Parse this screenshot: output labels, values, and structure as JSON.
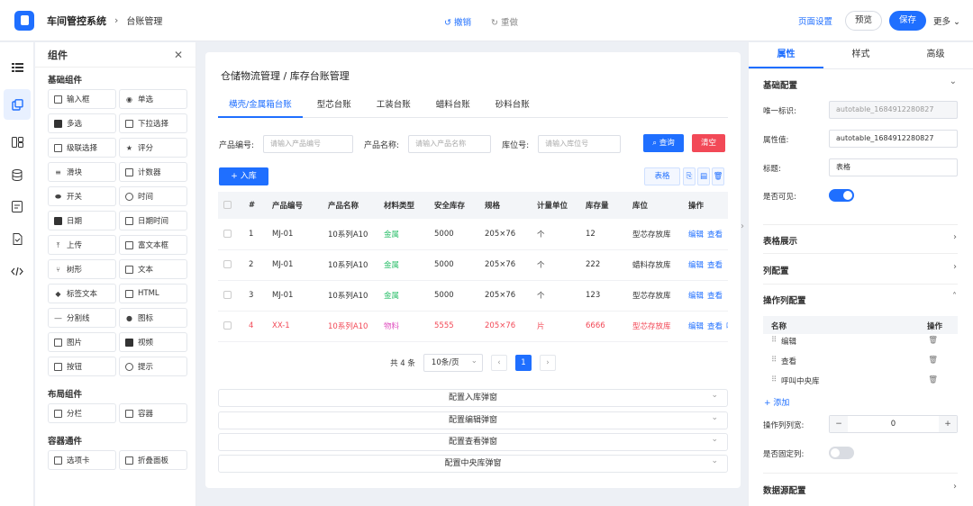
{
  "topbar": {
    "app_title": "车间管控系统",
    "breadcrumb": "台账管理",
    "undo": "撤销",
    "redo": "重做",
    "page_settings": "页面设置",
    "preview": "预览",
    "save": "保存",
    "more": "更多"
  },
  "components_panel": {
    "title": "组件",
    "basic_title": "基础组件",
    "basic": [
      "输入框",
      "单选",
      "多选",
      "下拉选择",
      "级联选择",
      "评分",
      "滑块",
      "计数器",
      "开关",
      "时间",
      "日期",
      "日期时间",
      "上传",
      "富文本框",
      "树形",
      "文本",
      "标签文本",
      "HTML",
      "分割线",
      "图标",
      "图片",
      "视频",
      "按钮",
      "提示"
    ],
    "layout_title": "布局组件",
    "layout": [
      "分栏",
      "容器"
    ],
    "container_title": "容器通件",
    "container": [
      "选项卡",
      "折叠面板"
    ]
  },
  "canvas": {
    "title": "仓储物流管理 / 库存台账管理",
    "tabs": [
      "横壳/金属箱台账",
      "型芯台账",
      "工装台账",
      "蜡料台账",
      "砂料台账"
    ],
    "search": {
      "code_label": "产品编号:",
      "code_placeholder": "请输入产品编号",
      "name_label": "产品名称:",
      "name_placeholder": "请输入产品名称",
      "loc_label": "库位号:",
      "loc_placeholder": "请输入库位号",
      "query": "查询",
      "clear": "清空"
    },
    "add_btn": "入库",
    "table_btn": "表格",
    "table": {
      "headers": [
        "#",
        "产品编号",
        "产品名称",
        "材料类型",
        "安全库存",
        "规格",
        "计量单位",
        "库存量",
        "库位",
        "操作"
      ],
      "rows": [
        [
          "1",
          "MJ-01",
          "10系列A10",
          "金属",
          "5000",
          "205×76",
          "个",
          "12",
          "型芯存放库"
        ],
        [
          "2",
          "MJ-01",
          "10系列A10",
          "金属",
          "5000",
          "205×76",
          "个",
          "222",
          "蜡料存放库"
        ],
        [
          "3",
          "MJ-01",
          "10系列A10",
          "金属",
          "5000",
          "205×76",
          "个",
          "123",
          "型芯存放库"
        ],
        [
          "4",
          "XX-1",
          "10系列A10",
          "物料",
          "5555",
          "205×76",
          "片",
          "6666",
          "型芯存放库"
        ]
      ],
      "op_edit": "编辑",
      "op_view": "查看",
      "op_extra": "呼"
    },
    "pager": {
      "total": "共 4 条",
      "page_size": "10条/页",
      "current": "1"
    },
    "collapses": [
      "配置入库弹窗",
      "配置编辑弹窗",
      "配置查看弹窗",
      "配置中央库弹窗"
    ]
  },
  "props_panel": {
    "tabs": [
      "属性",
      "样式",
      "高级"
    ],
    "basic_config": "基础配置",
    "uid_label": "唯一标识:",
    "uid_value": "autotable_1684912280827",
    "attr_label": "属性值:",
    "attr_value": "autotable_1684912280827",
    "title_label": "标题:",
    "title_value": "表格",
    "visible_label": "是否可见:",
    "visible": true,
    "table_display": "表格展示",
    "column_config": "列配置",
    "op_column_config": "操作列配置",
    "op_head_name": "名称",
    "op_head_action": "操作",
    "op_items": [
      "编辑",
      "查看",
      "呼叫中央库"
    ],
    "add": "添加",
    "op_width_label": "操作列列宽:",
    "op_width_value": "0",
    "fixed_label": "是否固定列:",
    "fixed": false,
    "datasource": "数据源配置"
  },
  "colors": {
    "primary": "#1f6fff",
    "danger": "#f24957",
    "success": "#2bbf6a"
  }
}
